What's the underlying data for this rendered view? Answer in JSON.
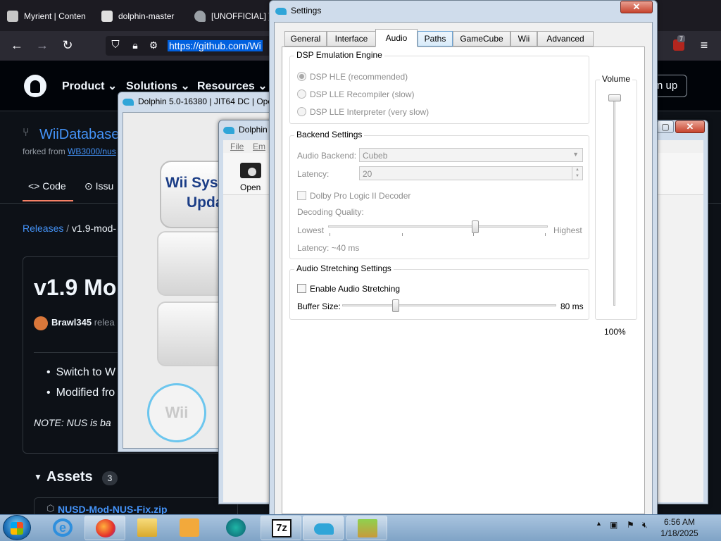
{
  "browser": {
    "tabs": [
      {
        "label": "Myrient | Conten",
        "color": "#c7c7c7"
      },
      {
        "label": "dolphin-master",
        "color": "#e0e0e0"
      },
      {
        "label": "[UNOFFICIAL] ]",
        "color": "#9aa0a6"
      }
    ],
    "url": "https://github.com/Wi",
    "badge_count": "7"
  },
  "github": {
    "nav": [
      "Product",
      "Solutions",
      "Resources"
    ],
    "signup": "n up",
    "repo_name": "WiiDatabase",
    "forked_prefix": "forked from",
    "forked_link": "WB3000/nus",
    "tabs": [
      "Code",
      "Issu"
    ],
    "breadcrumb_link": "Releases",
    "breadcrumb_sep": "/",
    "breadcrumb_current": "v1.9-mod-",
    "release_title": "v1.9 Mo",
    "author": "Brawl345",
    "author_suffix": "relea",
    "bullets": [
      "Switch to W",
      "Modified fro"
    ],
    "note": "NOTE: NUS is ba",
    "assets_label": "Assets",
    "assets_count": "3",
    "asset_file": "NUSD-Mod-NUS-Fix.zip"
  },
  "dolphin_main": {
    "title": "Dolphin 5.0-16380 | JIT64 DC | Ope",
    "banner_line1": "Wii Sys",
    "banner_line2": "Upda",
    "wii_logo": "Wii"
  },
  "dolphin_second": {
    "title": "Dolphin",
    "menu": [
      "File",
      "Em"
    ],
    "open_label": "Open"
  },
  "settings": {
    "title": "Settings",
    "tabs": [
      "General",
      "Interface",
      "Audio",
      "Paths",
      "GameCube",
      "Wii",
      "Advanced"
    ],
    "active_tab": "Audio",
    "dsp": {
      "title": "DSP Emulation Engine",
      "options": [
        "DSP HLE (recommended)",
        "DSP LLE Recompiler (slow)",
        "DSP LLE Interpreter (very slow)"
      ],
      "selected_index": 0
    },
    "backend": {
      "title": "Backend Settings",
      "audio_backend_label": "Audio Backend:",
      "audio_backend_value": "Cubeb",
      "latency_label": "Latency:",
      "latency_value": "20",
      "dolby_label": "Dolby Pro Logic II Decoder",
      "decoding_quality_label": "Decoding Quality:",
      "quality_low": "Lowest",
      "quality_high": "Highest",
      "quality_level": 0.67,
      "latency_readout": "Latency: ~40 ms"
    },
    "stretching": {
      "title": "Audio Stretching Settings",
      "enable_label": "Enable Audio Stretching",
      "buffer_label": "Buffer Size:",
      "buffer_value": "80 ms",
      "buffer_level": 0.25
    },
    "volume": {
      "title": "Volume",
      "value": "100%",
      "level": 1.0
    }
  },
  "taskbar": {
    "time": "6:56 AM",
    "date": "1/18/2025",
    "tray_arrow": "▲"
  }
}
